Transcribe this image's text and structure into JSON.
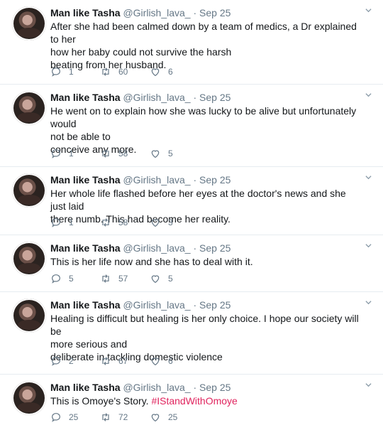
{
  "tweets": [
    {
      "name": "Man like Tasha",
      "handle": "@Girlish_lava_",
      "separator": "·",
      "date": "Sep 25",
      "lines": [
        "After she had been calmed down by a team of medics, a Dr explained to her",
        "how her baby could not survive the harsh",
        "beating from her husband."
      ],
      "replies": "1",
      "retweets": "60",
      "likes": "6"
    },
    {
      "name": "Man like Tasha",
      "handle": "@Girlish_lava_",
      "separator": "·",
      "date": "Sep 25",
      "lines": [
        "He went on to explain how she was lucky to be alive but unfortunately would",
        "not be able to",
        "conceive any more."
      ],
      "replies": "1",
      "retweets": "58",
      "likes": "5"
    },
    {
      "name": "Man like Tasha",
      "handle": "@Girlish_lava_",
      "separator": "·",
      "date": "Sep 25",
      "lines": [
        "Her whole life flashed before her eyes at the doctor's news and she just laid",
        "there numb. This had become her reality."
      ],
      "replies": "1",
      "retweets": "58",
      "likes": "3"
    },
    {
      "name": "Man like Tasha",
      "handle": "@Girlish_lava_",
      "separator": "·",
      "date": "Sep 25",
      "lines": [
        "This is her life now and she has to deal with it."
      ],
      "replies": "5",
      "retweets": "57",
      "likes": "5"
    },
    {
      "name": "Man like Tasha",
      "handle": "@Girlish_lava_",
      "separator": "·",
      "date": "Sep 25",
      "lines": [
        "Healing is difficult but healing is her only choice. I hope our society will be",
        "more serious and",
        "deliberate in tackling domestic violence"
      ],
      "replies": "2",
      "retweets": "67",
      "likes": "6"
    },
    {
      "name": "Man like Tasha",
      "handle": "@Girlish_lava_",
      "separator": "·",
      "date": "Sep 25",
      "text_prefix": "This is Omoye's Story. ",
      "hashtag": "#IStandWithOmoye",
      "replies": "25",
      "retweets": "72",
      "likes": "25"
    }
  ],
  "icons": {
    "reply": "reply-icon",
    "retweet": "retweet-icon",
    "like": "heart-icon",
    "caret": "chevron-down-icon"
  },
  "colors": {
    "thread_line": "#e5a2ad",
    "hashtag": "#e0245e",
    "secondary_text": "#657786"
  }
}
